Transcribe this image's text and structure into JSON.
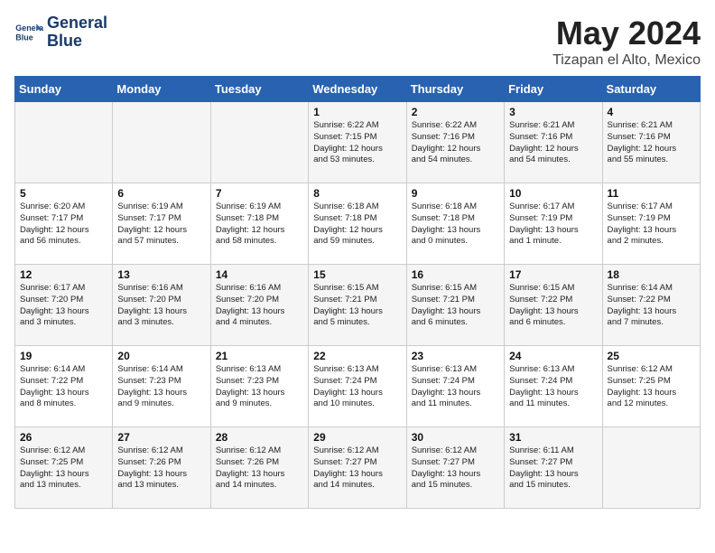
{
  "logo": {
    "name1": "General",
    "name2": "Blue"
  },
  "title": "May 2024",
  "subtitle": "Tizapan el Alto, Mexico",
  "headers": [
    "Sunday",
    "Monday",
    "Tuesday",
    "Wednesday",
    "Thursday",
    "Friday",
    "Saturday"
  ],
  "weeks": [
    [
      {
        "day": "",
        "info": ""
      },
      {
        "day": "",
        "info": ""
      },
      {
        "day": "",
        "info": ""
      },
      {
        "day": "1",
        "info": "Sunrise: 6:22 AM\nSunset: 7:15 PM\nDaylight: 12 hours\nand 53 minutes."
      },
      {
        "day": "2",
        "info": "Sunrise: 6:22 AM\nSunset: 7:16 PM\nDaylight: 12 hours\nand 54 minutes."
      },
      {
        "day": "3",
        "info": "Sunrise: 6:21 AM\nSunset: 7:16 PM\nDaylight: 12 hours\nand 54 minutes."
      },
      {
        "day": "4",
        "info": "Sunrise: 6:21 AM\nSunset: 7:16 PM\nDaylight: 12 hours\nand 55 minutes."
      }
    ],
    [
      {
        "day": "5",
        "info": "Sunrise: 6:20 AM\nSunset: 7:17 PM\nDaylight: 12 hours\nand 56 minutes."
      },
      {
        "day": "6",
        "info": "Sunrise: 6:19 AM\nSunset: 7:17 PM\nDaylight: 12 hours\nand 57 minutes."
      },
      {
        "day": "7",
        "info": "Sunrise: 6:19 AM\nSunset: 7:18 PM\nDaylight: 12 hours\nand 58 minutes."
      },
      {
        "day": "8",
        "info": "Sunrise: 6:18 AM\nSunset: 7:18 PM\nDaylight: 12 hours\nand 59 minutes."
      },
      {
        "day": "9",
        "info": "Sunrise: 6:18 AM\nSunset: 7:18 PM\nDaylight: 13 hours\nand 0 minutes."
      },
      {
        "day": "10",
        "info": "Sunrise: 6:17 AM\nSunset: 7:19 PM\nDaylight: 13 hours\nand 1 minute."
      },
      {
        "day": "11",
        "info": "Sunrise: 6:17 AM\nSunset: 7:19 PM\nDaylight: 13 hours\nand 2 minutes."
      }
    ],
    [
      {
        "day": "12",
        "info": "Sunrise: 6:17 AM\nSunset: 7:20 PM\nDaylight: 13 hours\nand 3 minutes."
      },
      {
        "day": "13",
        "info": "Sunrise: 6:16 AM\nSunset: 7:20 PM\nDaylight: 13 hours\nand 3 minutes."
      },
      {
        "day": "14",
        "info": "Sunrise: 6:16 AM\nSunset: 7:20 PM\nDaylight: 13 hours\nand 4 minutes."
      },
      {
        "day": "15",
        "info": "Sunrise: 6:15 AM\nSunset: 7:21 PM\nDaylight: 13 hours\nand 5 minutes."
      },
      {
        "day": "16",
        "info": "Sunrise: 6:15 AM\nSunset: 7:21 PM\nDaylight: 13 hours\nand 6 minutes."
      },
      {
        "day": "17",
        "info": "Sunrise: 6:15 AM\nSunset: 7:22 PM\nDaylight: 13 hours\nand 6 minutes."
      },
      {
        "day": "18",
        "info": "Sunrise: 6:14 AM\nSunset: 7:22 PM\nDaylight: 13 hours\nand 7 minutes."
      }
    ],
    [
      {
        "day": "19",
        "info": "Sunrise: 6:14 AM\nSunset: 7:22 PM\nDaylight: 13 hours\nand 8 minutes."
      },
      {
        "day": "20",
        "info": "Sunrise: 6:14 AM\nSunset: 7:23 PM\nDaylight: 13 hours\nand 9 minutes."
      },
      {
        "day": "21",
        "info": "Sunrise: 6:13 AM\nSunset: 7:23 PM\nDaylight: 13 hours\nand 9 minutes."
      },
      {
        "day": "22",
        "info": "Sunrise: 6:13 AM\nSunset: 7:24 PM\nDaylight: 13 hours\nand 10 minutes."
      },
      {
        "day": "23",
        "info": "Sunrise: 6:13 AM\nSunset: 7:24 PM\nDaylight: 13 hours\nand 11 minutes."
      },
      {
        "day": "24",
        "info": "Sunrise: 6:13 AM\nSunset: 7:24 PM\nDaylight: 13 hours\nand 11 minutes."
      },
      {
        "day": "25",
        "info": "Sunrise: 6:12 AM\nSunset: 7:25 PM\nDaylight: 13 hours\nand 12 minutes."
      }
    ],
    [
      {
        "day": "26",
        "info": "Sunrise: 6:12 AM\nSunset: 7:25 PM\nDaylight: 13 hours\nand 13 minutes."
      },
      {
        "day": "27",
        "info": "Sunrise: 6:12 AM\nSunset: 7:26 PM\nDaylight: 13 hours\nand 13 minutes."
      },
      {
        "day": "28",
        "info": "Sunrise: 6:12 AM\nSunset: 7:26 PM\nDaylight: 13 hours\nand 14 minutes."
      },
      {
        "day": "29",
        "info": "Sunrise: 6:12 AM\nSunset: 7:27 PM\nDaylight: 13 hours\nand 14 minutes."
      },
      {
        "day": "30",
        "info": "Sunrise: 6:12 AM\nSunset: 7:27 PM\nDaylight: 13 hours\nand 15 minutes."
      },
      {
        "day": "31",
        "info": "Sunrise: 6:11 AM\nSunset: 7:27 PM\nDaylight: 13 hours\nand 15 minutes."
      },
      {
        "day": "",
        "info": ""
      }
    ]
  ]
}
